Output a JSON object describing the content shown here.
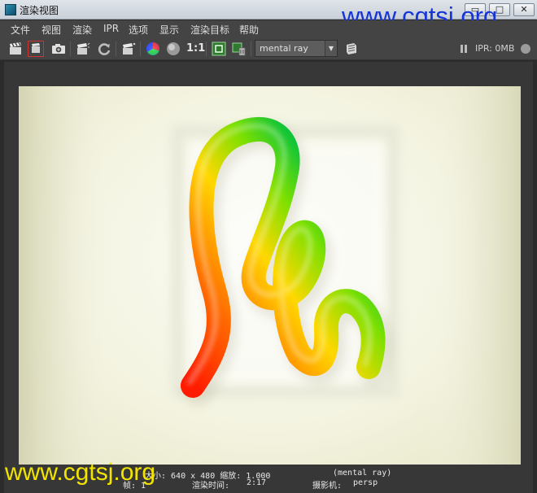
{
  "window": {
    "title": "渲染视图",
    "minimize_glyph": "▭",
    "maximize_glyph": "□",
    "close_glyph": "✕"
  },
  "watermark": {
    "top": "www.cgtsj.org",
    "bottom": "www.cgtsj.org"
  },
  "menu": [
    "文件",
    "视图",
    "渲染",
    "IPR",
    "选项",
    "显示",
    "渲染目标",
    "帮助"
  ],
  "toolbar": {
    "ratio_label": "1:1",
    "renderer_value": "mental ray",
    "ipr_status": "IPR: 0MB"
  },
  "status": {
    "size_line": "大小: 640 x 480  缩放: 1.000",
    "renderer_tag": "(mental ray)",
    "frame_label": "帧: 1",
    "render_time_label": "渲染时间:",
    "render_time_value": "2:17",
    "camera_label": "摄影机:",
    "camera_value": "persp"
  },
  "colors": {
    "title_bg": "#d6dce3",
    "panel_bg": "#444444",
    "viewport_bg": "#373737",
    "watermark_top": "#1535d8",
    "watermark_bottom": "#f2e400"
  }
}
